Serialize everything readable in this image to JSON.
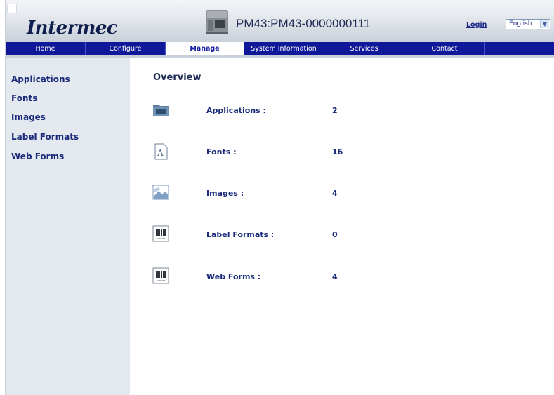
{
  "header": {
    "logo_text": "Intermec",
    "printer_title": "PM43:PM43-0000000111",
    "login_label": "Login",
    "language": "English"
  },
  "nav": {
    "items": [
      {
        "label": "Home"
      },
      {
        "label": "Configure"
      },
      {
        "label": "Manage"
      },
      {
        "label": "System Information"
      },
      {
        "label": "Services"
      },
      {
        "label": "Contact"
      }
    ],
    "active": "Manage"
  },
  "sidebar": {
    "items": [
      {
        "label": "Applications"
      },
      {
        "label": "Fonts"
      },
      {
        "label": "Images"
      },
      {
        "label": "Label Formats"
      },
      {
        "label": "Web Forms"
      }
    ]
  },
  "main": {
    "title": "Overview",
    "rows": [
      {
        "label": "Applications :",
        "value": "2",
        "icon": "folder-icon"
      },
      {
        "label": "Fonts :",
        "value": "16",
        "icon": "font-icon"
      },
      {
        "label": "Images :",
        "value": "4",
        "icon": "image-icon"
      },
      {
        "label": "Label Formats :",
        "value": "0",
        "icon": "barcode-format-icon"
      },
      {
        "label": "Web Forms :",
        "value": "4",
        "icon": "barcode-format-icon"
      }
    ],
    "format_icon_caption": "FORMAT"
  },
  "colors": {
    "nav_bg": "#10189a",
    "text_accent": "#1a2a7a",
    "sidebar_bg": "#e4e9ef"
  }
}
